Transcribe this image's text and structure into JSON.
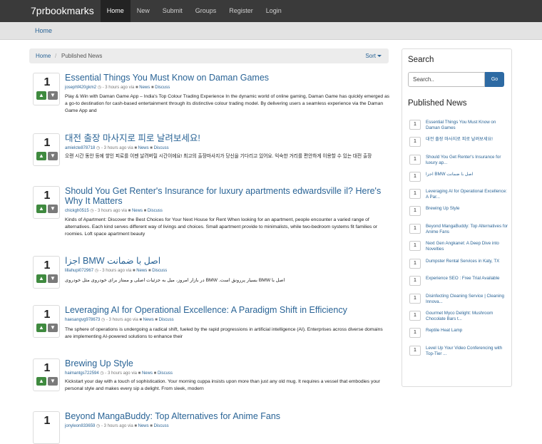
{
  "navbar": {
    "brand": "7prbookmarks",
    "items": [
      "Home",
      "New",
      "Submit",
      "Groups",
      "Register",
      "Login"
    ]
  },
  "subbar": {
    "label": "Home"
  },
  "breadcrumb": {
    "home": "Home",
    "current": "Published News",
    "sort": "Sort"
  },
  "stories": [
    {
      "votes": "1",
      "title": "Essential Things You Must Know on Daman Games",
      "user": "josephf420gkm2",
      "time": "3 hours ago",
      "category": "News",
      "discuss": "Discuss",
      "desc": "Play & Win with Daman Game App – India's Top Colour Trading Experience In the dynamic world of online gaming, Daman Game has quickly emerged as a go-to destination for cash-based entertainment through its distinctive colour trading model. By delivering users a seamless experience via the Daman Game App and"
    },
    {
      "votes": "1",
      "title": "대전 출장 마사지로 피로 날려보세요!",
      "user": "amielcte878718",
      "time": "3 hours ago",
      "category": "News",
      "discuss": "Discuss",
      "desc": "오랜 시간 동안 등에 쌓인 피로를 이젠 날려버릴 시간이에요! 최고의 출장마사지가 당신을 기다리고 있어요. 익숙한 거리를 편안하게 이용할 수 있는 대전 출장"
    },
    {
      "votes": "1",
      "title": "Should You Get Renter's Insurance for luxury apartments edwardsville il? Here's Why It Matters",
      "user": "chickgh0515",
      "time": "3 hours ago",
      "category": "News",
      "discuss": "Discuss",
      "desc": "Kinds of Apartment: Discover the Best Choices for Your Next House for Rent When looking for an apartment, people encounter a varied range of alternatives. Each kind serves different way of livings and choices. Small apartment provide to minimalists, while two-bedroom systems fit families or roomies. Loft space apartment beauty"
    },
    {
      "votes": "1",
      "title": "اجزا BMW اصل با ضمانت",
      "user": "lillahupi072967",
      "time": "3 hours ago",
      "category": "News",
      "discuss": "Discuss",
      "desc": "اصل با BMW بسیار پررونق است. BMW در بازار امروز، میل به جزئیات اصلی و ممتاز برای خودروی مثل خودروی"
    },
    {
      "votes": "1",
      "title": "Leveraging AI for Operational Excellence: A Paradigm Shift in Efficiency",
      "user": "haesangvg978673",
      "time": "3 hours ago",
      "category": "News",
      "discuss": "Discuss",
      "desc": "The sphere of operations is undergoing a radical shift, fueled by the rapid progressions in artificial intelligence (AI). Enterprises across diverse domains are implementing AI-powered solutions to enhance their"
    },
    {
      "votes": "1",
      "title": "Brewing Up Style",
      "user": "haimantgs722594",
      "time": "3 hours ago",
      "category": "News",
      "discuss": "Discuss",
      "desc": "Kickstart your day with a touch of sophistication. Your morning cuppa insists upon more than just any old mug. It requires a vessel that embodies your personal style and makes every sip a delight. From sleek, modern"
    },
    {
      "votes": "1",
      "title": "Beyond MangaBuddy: Top Alternatives for Anime Fans",
      "user": "jonyleon833659",
      "time": "3 hours ago",
      "category": "News",
      "discuss": "Discuss",
      "desc": ""
    }
  ],
  "sidebar": {
    "search_title": "Search",
    "search_placeholder": "Search..",
    "go_label": "Go",
    "published_title": "Published News",
    "items": [
      {
        "votes": "1",
        "label": "Essential Things You Must Know on Daman Games"
      },
      {
        "votes": "1",
        "label": "대전 출장 마사지로 피로 날려보세요!"
      },
      {
        "votes": "1",
        "label": "Should You Get Renter's Insurance for luxury ap..."
      },
      {
        "votes": "1",
        "label": "اجزا BMW اصل با ضمانت"
      },
      {
        "votes": "1",
        "label": "Leveraging AI for Operational Excellence: A Par..."
      },
      {
        "votes": "1",
        "label": "Brewing Up Style"
      },
      {
        "votes": "1",
        "label": "Beyond MangaBuddy: Top Alternatives for Anime Fans"
      },
      {
        "votes": "1",
        "label": "Next Gen Angkanet: A Deep Dive into Novelties"
      },
      {
        "votes": "1",
        "label": "Dumpster Rental Services in Katy, TX"
      },
      {
        "votes": "1",
        "label": "Experience SEO : Free Trial Available"
      },
      {
        "votes": "1",
        "label": "Disinfecting Cleaning Service | Cleaning Innova..."
      },
      {
        "votes": "1",
        "label": "Gourmet Myco Delight: Mushroom Chocolate Bars t..."
      },
      {
        "votes": "1",
        "label": "Reptile Heat Lamp"
      },
      {
        "votes": "1",
        "label": "Level Up Your Video Conferencing with Top-Tier ..."
      }
    ]
  }
}
